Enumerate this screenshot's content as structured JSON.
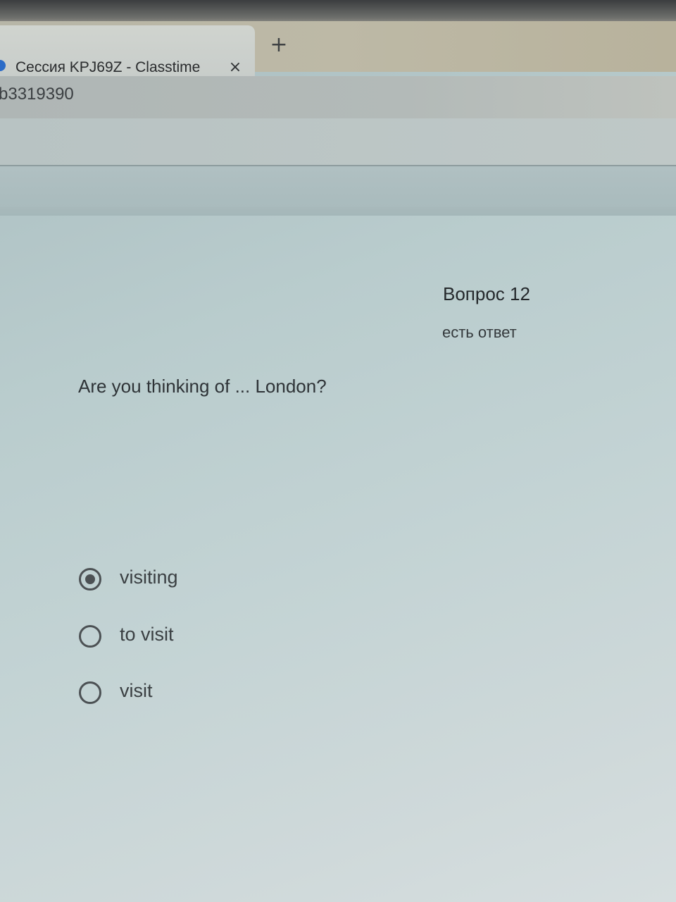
{
  "browser": {
    "tab_title": "Сессия KPJ69Z - Classtime",
    "close_symbol": "×",
    "new_tab_symbol": "+",
    "address_fragment": "b3319390"
  },
  "question": {
    "number_label": "Вопрос 12",
    "status": "есть ответ",
    "text": "Are you thinking of ... London?"
  },
  "options": [
    {
      "label": "visiting",
      "selected": true
    },
    {
      "label": "to visit",
      "selected": false
    },
    {
      "label": "visit",
      "selected": false
    }
  ]
}
